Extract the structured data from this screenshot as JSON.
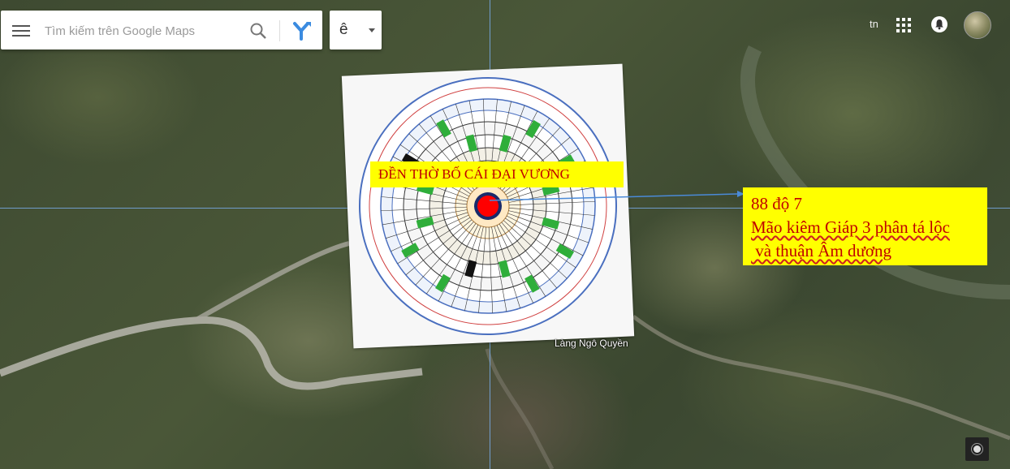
{
  "search": {
    "placeholder": "Tìm kiếm trên Google Maps"
  },
  "input_tool": {
    "label": "ê"
  },
  "top_right": {
    "lang": "tn"
  },
  "overlay": {
    "temple_label": "ĐỀN THỜ BỐ CÁI ĐẠI VƯƠNG",
    "info_line1": "88 độ 7",
    "info_line2": "Mão kiêm Giáp 3 phân tá lộc",
    "info_line3": " và thuận Âm dương"
  },
  "map": {
    "place_label": "Làng Ngô Quyền"
  },
  "colors": {
    "highlight": "#ffff00",
    "text_red": "#c00000",
    "crosshair": "#78aae6",
    "compass_center": "#ff0000"
  }
}
